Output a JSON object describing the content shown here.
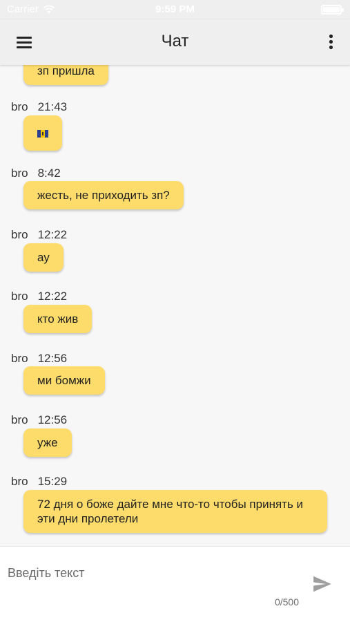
{
  "status_bar": {
    "carrier": "Carrier",
    "time": "9:59 PM"
  },
  "app_bar": {
    "title": "Чат",
    "menu_icon": "hamburger-menu-icon",
    "more_icon": "more-vertical-icon"
  },
  "messages": [
    {
      "sender": "",
      "time": "",
      "text": "зп пришла"
    },
    {
      "sender": "bro",
      "time": "21:43",
      "text": "",
      "icon": "flag-icon"
    },
    {
      "sender": "bro",
      "time": "8:42",
      "text": "жесть, не приходить зп?"
    },
    {
      "sender": "bro",
      "time": "12:22",
      "text": "ау"
    },
    {
      "sender": "bro",
      "time": "12:22",
      "text": "кто жив"
    },
    {
      "sender": "bro",
      "time": "12:56",
      "text": "ми бомжи"
    },
    {
      "sender": "bro",
      "time": "12:56",
      "text": "уже"
    },
    {
      "sender": "bro",
      "time": "15:29",
      "text": "72 дня о боже дайте мне что-то чтобы принять и эти дни пролетели"
    }
  ],
  "composer": {
    "placeholder": "Введіть текст",
    "value": "",
    "counter": "0/500",
    "send_icon": "send-icon"
  },
  "colors": {
    "bubble": "#fddc6c",
    "app_bar": "#efefef",
    "background": "#f7f7f7"
  }
}
